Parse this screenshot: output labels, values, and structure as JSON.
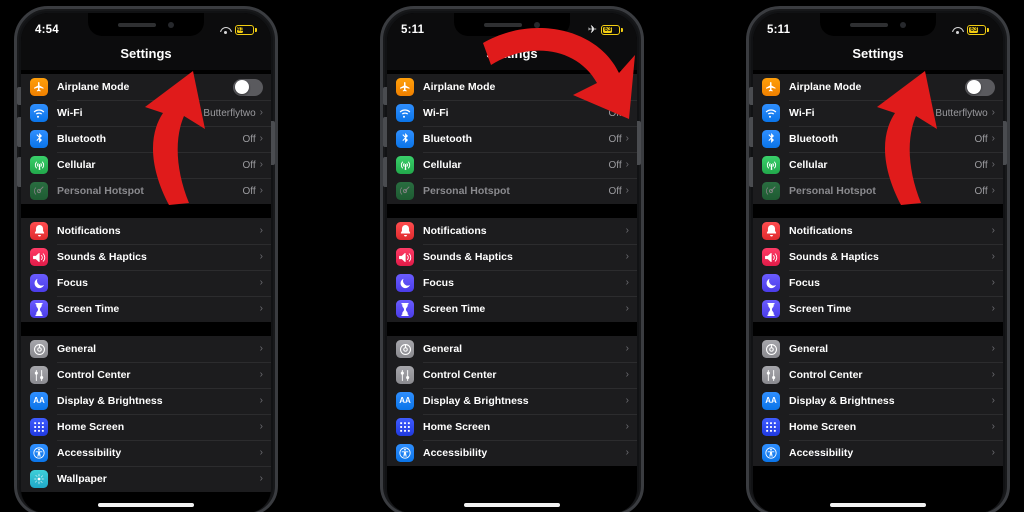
{
  "background_color": "#000000",
  "accent_colors": {
    "toggle_on": "#34c759",
    "toggle_off": "#5a5a5e",
    "arrow": "#e01b1b",
    "battery_low_power": "#f2cd12",
    "list_background": "#1c1c1e"
  },
  "phones": [
    {
      "id": "phone-before-left",
      "status_bar": {
        "time": "4:54",
        "icons": [
          "wifi-icon",
          "battery-icon"
        ],
        "battery_level": "41"
      },
      "nav_title": "Settings",
      "airplane_toggle_state": "off",
      "arrow": {
        "direction": "up",
        "points_to": "airplane-mode-toggle"
      },
      "groups": [
        {
          "rows": [
            {
              "icon": "airplane-icon",
              "label": "Airplane Mode",
              "control": "toggle",
              "toggle": "off",
              "dimmed": false
            },
            {
              "icon": "wifi-icon",
              "label": "Wi-Fi",
              "value": "Butterflytwo",
              "control": "chevron",
              "dimmed": false
            },
            {
              "icon": "bluetooth-icon",
              "label": "Bluetooth",
              "value": "Off",
              "control": "chevron",
              "dimmed": false
            },
            {
              "icon": "cellular-icon",
              "label": "Cellular",
              "value": "Off",
              "control": "chevron",
              "dimmed": false
            },
            {
              "icon": "hotspot-icon",
              "label": "Personal Hotspot",
              "value": "Off",
              "control": "chevron",
              "dimmed": true
            }
          ]
        },
        {
          "rows": [
            {
              "icon": "notifications-icon",
              "label": "Notifications",
              "value": "",
              "control": "chevron",
              "dimmed": false
            },
            {
              "icon": "sounds-icon",
              "label": "Sounds & Haptics",
              "value": "",
              "control": "chevron",
              "dimmed": false
            },
            {
              "icon": "focus-icon",
              "label": "Focus",
              "value": "",
              "control": "chevron",
              "dimmed": false
            },
            {
              "icon": "screentime-icon",
              "label": "Screen Time",
              "value": "",
              "control": "chevron",
              "dimmed": false
            }
          ]
        },
        {
          "rows": [
            {
              "icon": "general-icon",
              "label": "General",
              "value": "",
              "control": "chevron",
              "dimmed": false
            },
            {
              "icon": "control-center-icon",
              "label": "Control Center",
              "value": "",
              "control": "chevron",
              "dimmed": false
            },
            {
              "icon": "display-icon",
              "label": "Display & Brightness",
              "value": "",
              "control": "chevron",
              "dimmed": false
            },
            {
              "icon": "home-screen-icon",
              "label": "Home Screen",
              "value": "",
              "control": "chevron",
              "dimmed": false
            },
            {
              "icon": "accessibility-icon",
              "label": "Accessibility",
              "value": "",
              "control": "chevron",
              "dimmed": false
            },
            {
              "icon": "wallpaper-icon",
              "label": "Wallpaper",
              "value": "",
              "control": "chevron",
              "dimmed": false
            }
          ]
        }
      ]
    },
    {
      "id": "phone-airplane-on-middle",
      "status_bar": {
        "time": "5:11",
        "icons": [
          "airplane-icon",
          "battery-icon"
        ],
        "battery_level": "63"
      },
      "nav_title": "Settings",
      "airplane_toggle_state": "on",
      "arrow": {
        "direction": "down-right",
        "points_to": "airplane-mode-toggle"
      },
      "groups": [
        {
          "rows": [
            {
              "icon": "airplane-icon",
              "label": "Airplane Mode",
              "control": "toggle",
              "toggle": "on",
              "dimmed": false
            },
            {
              "icon": "wifi-icon",
              "label": "Wi-Fi",
              "value": "Off",
              "control": "chevron",
              "dimmed": false
            },
            {
              "icon": "bluetooth-icon",
              "label": "Bluetooth",
              "value": "Off",
              "control": "chevron",
              "dimmed": false
            },
            {
              "icon": "cellular-icon",
              "label": "Cellular",
              "value": "Off",
              "control": "chevron",
              "dimmed": false
            },
            {
              "icon": "hotspot-icon",
              "label": "Personal Hotspot",
              "value": "Off",
              "control": "chevron",
              "dimmed": true
            }
          ]
        },
        {
          "rows": [
            {
              "icon": "notifications-icon",
              "label": "Notifications",
              "value": "",
              "control": "chevron",
              "dimmed": false
            },
            {
              "icon": "sounds-icon",
              "label": "Sounds & Haptics",
              "value": "",
              "control": "chevron",
              "dimmed": false
            },
            {
              "icon": "focus-icon",
              "label": "Focus",
              "value": "",
              "control": "chevron",
              "dimmed": false
            },
            {
              "icon": "screentime-icon",
              "label": "Screen Time",
              "value": "",
              "control": "chevron",
              "dimmed": false
            }
          ]
        },
        {
          "rows": [
            {
              "icon": "general-icon",
              "label": "General",
              "value": "",
              "control": "chevron",
              "dimmed": false
            },
            {
              "icon": "control-center-icon",
              "label": "Control Center",
              "value": "",
              "control": "chevron",
              "dimmed": false
            },
            {
              "icon": "display-icon",
              "label": "Display & Brightness",
              "value": "",
              "control": "chevron",
              "dimmed": false
            },
            {
              "icon": "home-screen-icon",
              "label": "Home Screen",
              "value": "",
              "control": "chevron",
              "dimmed": false
            },
            {
              "icon": "accessibility-icon",
              "label": "Accessibility",
              "value": "",
              "control": "chevron",
              "dimmed": false
            }
          ]
        }
      ]
    },
    {
      "id": "phone-airplane-off-right",
      "status_bar": {
        "time": "5:11",
        "icons": [
          "wifi-icon",
          "battery-icon"
        ],
        "battery_level": "63"
      },
      "nav_title": "Settings",
      "airplane_toggle_state": "off",
      "arrow": {
        "direction": "up",
        "points_to": "airplane-mode-toggle"
      },
      "groups": [
        {
          "rows": [
            {
              "icon": "airplane-icon",
              "label": "Airplane Mode",
              "control": "toggle",
              "toggle": "off",
              "dimmed": false
            },
            {
              "icon": "wifi-icon",
              "label": "Wi-Fi",
              "value": "Butterflytwo",
              "control": "chevron",
              "dimmed": false
            },
            {
              "icon": "bluetooth-icon",
              "label": "Bluetooth",
              "value": "Off",
              "control": "chevron",
              "dimmed": false
            },
            {
              "icon": "cellular-icon",
              "label": "Cellular",
              "value": "Off",
              "control": "chevron",
              "dimmed": false
            },
            {
              "icon": "hotspot-icon",
              "label": "Personal Hotspot",
              "value": "Off",
              "control": "chevron",
              "dimmed": true
            }
          ]
        },
        {
          "rows": [
            {
              "icon": "notifications-icon",
              "label": "Notifications",
              "value": "",
              "control": "chevron",
              "dimmed": false
            },
            {
              "icon": "sounds-icon",
              "label": "Sounds & Haptics",
              "value": "",
              "control": "chevron",
              "dimmed": false
            },
            {
              "icon": "focus-icon",
              "label": "Focus",
              "value": "",
              "control": "chevron",
              "dimmed": false
            },
            {
              "icon": "screentime-icon",
              "label": "Screen Time",
              "value": "",
              "control": "chevron",
              "dimmed": false
            }
          ]
        },
        {
          "rows": [
            {
              "icon": "general-icon",
              "label": "General",
              "value": "",
              "control": "chevron",
              "dimmed": false
            },
            {
              "icon": "control-center-icon",
              "label": "Control Center",
              "value": "",
              "control": "chevron",
              "dimmed": false
            },
            {
              "icon": "display-icon",
              "label": "Display & Brightness",
              "value": "",
              "control": "chevron",
              "dimmed": false
            },
            {
              "icon": "home-screen-icon",
              "label": "Home Screen",
              "value": "",
              "control": "chevron",
              "dimmed": false
            },
            {
              "icon": "accessibility-icon",
              "label": "Accessibility",
              "value": "",
              "control": "chevron",
              "dimmed": false
            }
          ]
        }
      ]
    }
  ]
}
